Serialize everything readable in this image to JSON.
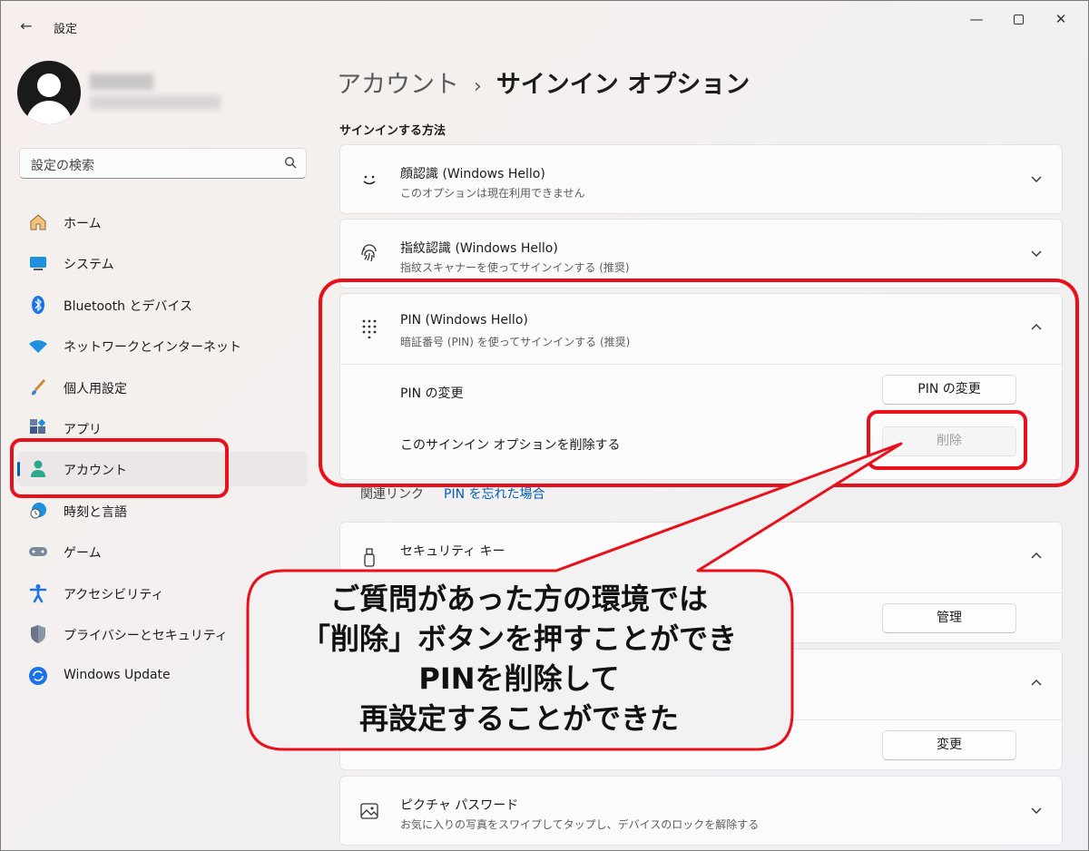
{
  "window": {
    "title": "設定",
    "back": "←",
    "minimize": "—",
    "close": "✕"
  },
  "sidebar": {
    "search_placeholder": "設定の検索",
    "items": [
      {
        "label": "ホーム",
        "icon": "home-icon"
      },
      {
        "label": "システム",
        "icon": "system-icon"
      },
      {
        "label": "Bluetooth とデバイス",
        "icon": "bluetooth-icon"
      },
      {
        "label": "ネットワークとインターネット",
        "icon": "wifi-icon"
      },
      {
        "label": "個人用設定",
        "icon": "brush-icon"
      },
      {
        "label": "アプリ",
        "icon": "apps-icon"
      },
      {
        "label": "アカウント",
        "icon": "account-icon",
        "active": true
      },
      {
        "label": "時刻と言語",
        "icon": "clock-globe-icon"
      },
      {
        "label": "ゲーム",
        "icon": "gamepad-icon"
      },
      {
        "label": "アクセシビリティ",
        "icon": "accessibility-icon"
      },
      {
        "label": "プライバシーとセキュリティ",
        "icon": "shield-icon"
      },
      {
        "label": "Windows Update",
        "icon": "update-icon"
      }
    ]
  },
  "main": {
    "breadcrumb_parent": "アカウント",
    "breadcrumb_sep": "›",
    "breadcrumb_current": "サインイン オプション",
    "section_title": "サインインする方法",
    "cards": {
      "face": {
        "title": "顔認識 (Windows Hello)",
        "subtitle": "このオプションは現在利用できません"
      },
      "fingerprint": {
        "title": "指紋認識 (Windows Hello)",
        "subtitle": "指紋スキャナーを使ってサインインする (推奨)"
      },
      "pin": {
        "title": "PIN (Windows Hello)",
        "subtitle": "暗証番号 (PIN) を使ってサインインする (推奨)",
        "change_label": "PIN の変更",
        "change_button": "PIN の変更",
        "remove_label": "このサインイン オプションを削除する",
        "remove_button": "削除"
      },
      "related_label": "関連リンク",
      "related_link": "PIN を忘れた場合",
      "security_key": {
        "title": "セキュリティ キー",
        "manage_button": "管理"
      },
      "password": {
        "change_button": "変更"
      },
      "picture": {
        "title": "ピクチャ パスワード",
        "subtitle": "お気に入りの写真をスワイプしてタップし、デバイスのロックを解除する"
      }
    }
  },
  "callout": {
    "lines": [
      "ご質問があった方の環境では",
      "「削除」ボタンを押すことができ",
      "PINを削除して",
      "再設定することができた"
    ]
  },
  "colors": {
    "accent": "#005fb8",
    "annotation_red": "#e8101a"
  }
}
